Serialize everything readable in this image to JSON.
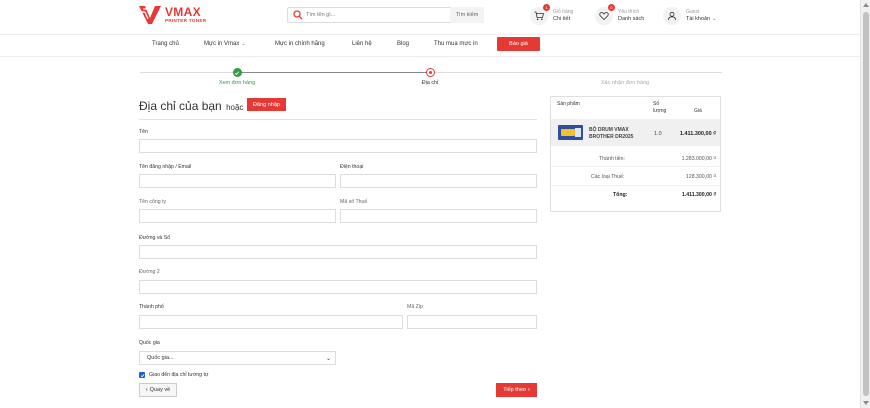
{
  "header": {
    "logo_name": "VMAX",
    "logo_sub": "PRINTER TONER",
    "search_placeholder": "Tìm tên gì...",
    "search_button": "Tìm kiếm",
    "cart": {
      "badge": "1",
      "line1": "Giỏ hàng",
      "line2": "Chi tiết"
    },
    "wishlist": {
      "badge": "0",
      "line1": "Yêu thích",
      "line2": "Danh sách"
    },
    "account": {
      "line1": "Guest",
      "line2": "Tài khoản"
    }
  },
  "nav": {
    "items": [
      "Trang chủ",
      "Mực in Vmax",
      "Mực in chính hãng",
      "Liên hệ",
      "Blog",
      "Thu mua mực in"
    ],
    "quote_button": "Báo giá"
  },
  "steps": [
    {
      "label": "Xem đơn hàng",
      "state": "done"
    },
    {
      "label": "Địa chỉ",
      "state": "current"
    },
    {
      "label": "Xác nhận đơn hàng",
      "state": "pending"
    }
  ],
  "form": {
    "title": "Địa chỉ của bạn",
    "or_text": "hoặc",
    "login_button": "Đăng nhập",
    "fields": {
      "name": "Tên",
      "username_email": "Tên đăng nhập / Email",
      "phone": "Điện thoại",
      "company": "Tên công ty",
      "tax_code": "Mã số Thuế",
      "street": "Đường và Số",
      "street2": "Đường 2",
      "city": "Thành phố",
      "zip": "Mã Zip",
      "country": "Quốc gia"
    },
    "country_select_value": "Quốc gia...",
    "ship_same_label": "Giao đến địa chỉ tương tự",
    "back_button": "Quay về",
    "next_button": "Tiếp theo"
  },
  "summary": {
    "headers": {
      "product": "Sản phẩm",
      "qty_line1": "Số",
      "qty_line2": "lượng",
      "price": "Giá"
    },
    "item": {
      "name_line1": "BỘ DRUM VMAX",
      "name_line2": "BROTHER DR2025",
      "qty": "1.0",
      "price": "1.411.300,00 ₫"
    },
    "subtotal_label": "Thành tiền:",
    "subtotal_value": "1.283.000,00 ₫",
    "tax_label": "Các loại Thuế:",
    "tax_value": "128.300,00 ₫",
    "total_label": "Tổng:",
    "total_value": "1.411.300,00 ₫"
  },
  "colors": {
    "accent": "#e53935",
    "success": "#2e9e3f",
    "checkbox": "#1e5fd6"
  }
}
